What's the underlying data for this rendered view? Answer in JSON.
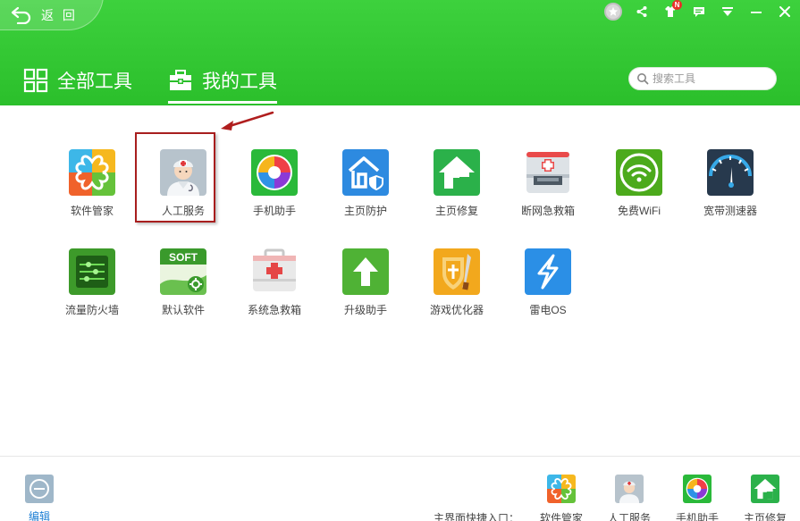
{
  "header": {
    "back_label": "返 回",
    "tabs": [
      {
        "label": "全部工具",
        "icon": "grid-icon",
        "active": false
      },
      {
        "label": "我的工具",
        "icon": "toolbox-icon",
        "active": true
      }
    ],
    "search": {
      "placeholder": "搜索工具"
    },
    "badge_letter": "N"
  },
  "tools": [
    {
      "label": "软件管家",
      "icon": "software-manager-icon"
    },
    {
      "label": "人工服务",
      "icon": "customer-service-icon"
    },
    {
      "label": "手机助手",
      "icon": "phone-assistant-icon"
    },
    {
      "label": "主页防护",
      "icon": "homepage-protect-icon"
    },
    {
      "label": "主页修复",
      "icon": "homepage-repair-icon"
    },
    {
      "label": "断网急救箱",
      "icon": "network-firstaid-icon"
    },
    {
      "label": "免费WiFi",
      "icon": "wifi-icon"
    },
    {
      "label": "宽带测速器",
      "icon": "speedometer-icon"
    },
    {
      "label": "流量防火墙",
      "icon": "traffic-firewall-icon"
    },
    {
      "label": "默认软件",
      "icon": "default-software-icon"
    },
    {
      "label": "系统急救箱",
      "icon": "system-firstaid-icon"
    },
    {
      "label": "升级助手",
      "icon": "upgrade-icon"
    },
    {
      "label": "游戏优化器",
      "icon": "game-optimizer-icon"
    },
    {
      "label": "雷电OS",
      "icon": "thunder-os-icon"
    }
  ],
  "soft_badge_text": "SOFT",
  "footer": {
    "edit_label": "编辑",
    "quick_label": "主界面快捷入口：",
    "quick_items": [
      {
        "label": "软件管家",
        "icon": "software-manager-icon"
      },
      {
        "label": "人工服务",
        "icon": "customer-service-icon"
      },
      {
        "label": "手机助手",
        "icon": "phone-assistant-icon"
      },
      {
        "label": "主页修复",
        "icon": "homepage-repair-icon"
      }
    ]
  },
  "colors": {
    "header_green": "#2bbf2b",
    "highlight_red": "#a81e1e",
    "edit_blue": "#1e7fd4"
  }
}
